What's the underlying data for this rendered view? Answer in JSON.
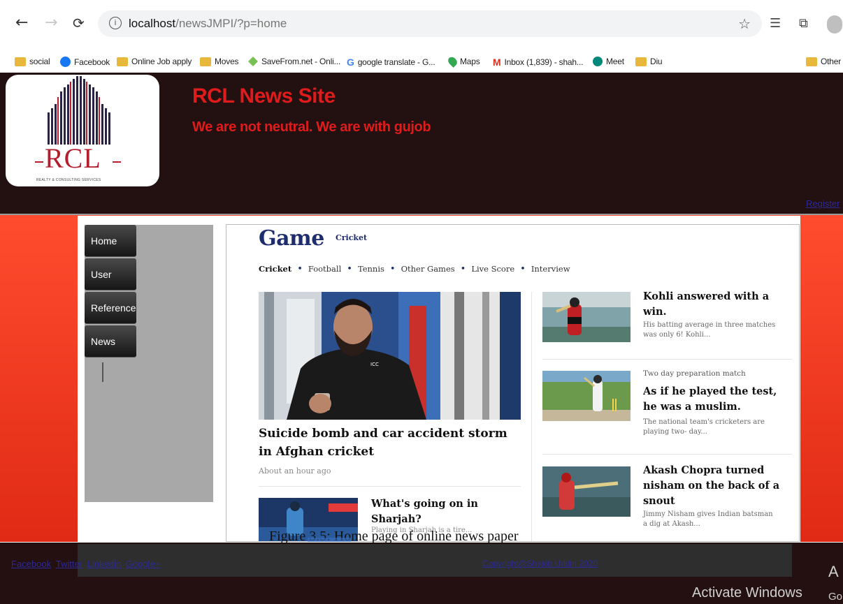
{
  "browser": {
    "back_icon": "←",
    "forward_icon": "→",
    "reload_icon": "⟳",
    "info_icon": "i",
    "url_host": "localhost",
    "url_path": "/newsJMPI/?p=home",
    "star_icon": "☆",
    "favorites_icon": "☰",
    "collections_icon": "⧉"
  },
  "bookmarks": [
    {
      "label": "social",
      "icon": "folder-icon"
    },
    {
      "label": "Facebook",
      "icon": "facebook-icon"
    },
    {
      "label": "Online Job apply",
      "icon": "folder-icon"
    },
    {
      "label": "Moves",
      "icon": "folder-icon"
    },
    {
      "label": "SaveFrom.net - Onli...",
      "icon": "savefrom-icon"
    },
    {
      "label": "google translate - G...",
      "icon": "google-icon"
    },
    {
      "label": "Maps",
      "icon": "maps-icon"
    },
    {
      "label": "Inbox (1,839) - shah...",
      "icon": "gmail-icon"
    },
    {
      "label": "Meet",
      "icon": "meet-icon"
    },
    {
      "label": "Diu",
      "icon": "folder-icon"
    },
    {
      "label": "Other",
      "icon": "folder-icon"
    }
  ],
  "site": {
    "logo_text": "RCL",
    "logo_tagline": "REALTY & CONSULTING SERVICES",
    "title": "RCL News Site",
    "tagline": "We are not neutral. We are with gujob",
    "register": "Register"
  },
  "menu": [
    "Home",
    "User",
    "Reference",
    "News"
  ],
  "section": {
    "title": "Game",
    "subtitle": "Cricket",
    "tabs": [
      "Cricket",
      "Football",
      "Tennis",
      "Other Games",
      "Live Score",
      "Interview"
    ],
    "tab_separator": "•"
  },
  "hero": {
    "title": "Suicide bomb and car accident storm in Afghan cricket",
    "time": "About an hour ago"
  },
  "small_article": {
    "title": "What's going on in Sharjah?",
    "desc": "Playing in Sharjah is a tire..."
  },
  "side_articles": [
    {
      "kicker": "",
      "title": "Kohli answered with a win.",
      "desc": "His batting average in three matches was only 6! Kohli..."
    },
    {
      "kicker": "Two day preparation match",
      "title": "As if he played the test, he was a muslim.",
      "desc": "The national team's cricketers are playing two- day..."
    },
    {
      "kicker": "",
      "title": "Akash Chopra turned nisham on the back of a snout",
      "desc": "Jimmy Nisham gives Indian batsman a dig at Akash..."
    }
  ],
  "caption": "Figure 3.5: Home page of online news paper",
  "footer": {
    "links": [
      "Facebook",
      "Twitter",
      "Linkedin",
      "Google+"
    ],
    "copyright": "Copyright@Shakib Uddin 2020",
    "activate": "Activate Windows",
    "activate_cut1": "A",
    "activate_cut2": "Go"
  }
}
